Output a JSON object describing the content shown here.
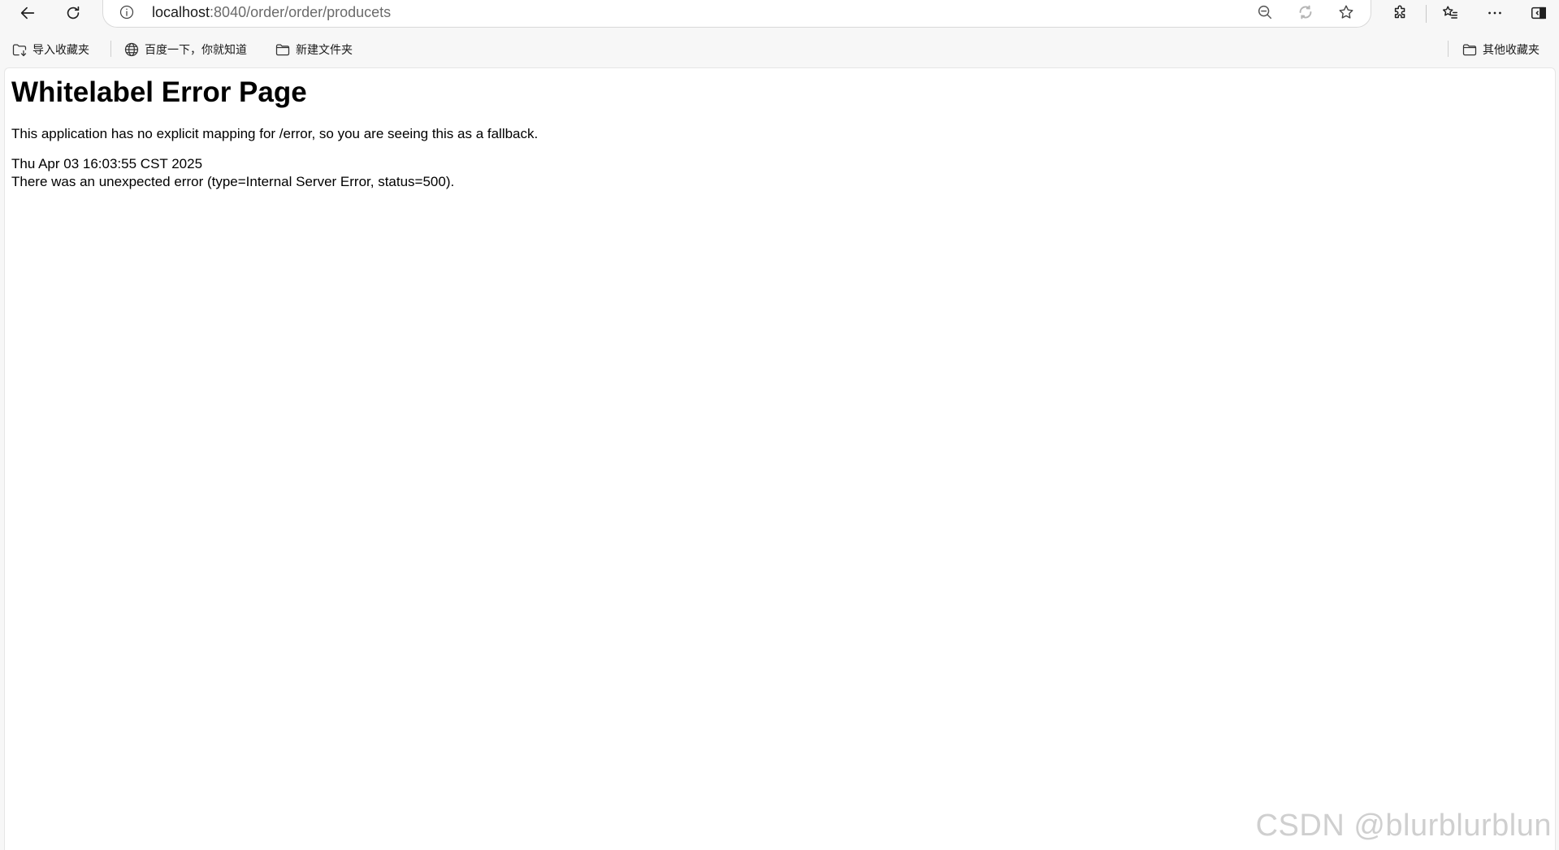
{
  "browser": {
    "url_host": "localhost",
    "url_path": ":8040/order/order/producets"
  },
  "bookmarks": [
    {
      "label": "导入收藏夹",
      "icon": "import-favorites-icon"
    },
    {
      "label": "百度一下，你就知道",
      "icon": "globe-icon"
    },
    {
      "label": "新建文件夹",
      "icon": "folder-icon"
    }
  ],
  "other_favorites": {
    "label": "其他收藏夹",
    "icon": "folder-icon"
  },
  "page": {
    "title": "Whitelabel Error Page",
    "message": "This application has no explicit mapping for /error, so you are seeing this as a fallback.",
    "timestamp": "Thu Apr 03 16:03:55 CST 2025",
    "error": "There was an unexpected error (type=Internal Server Error, status=500)."
  },
  "watermark": "CSDN @blurblurblun",
  "colors": {
    "toolbar_bg": "#f7f7f7",
    "content_bg": "#ffffff",
    "watermark": "#cfcfcf"
  }
}
